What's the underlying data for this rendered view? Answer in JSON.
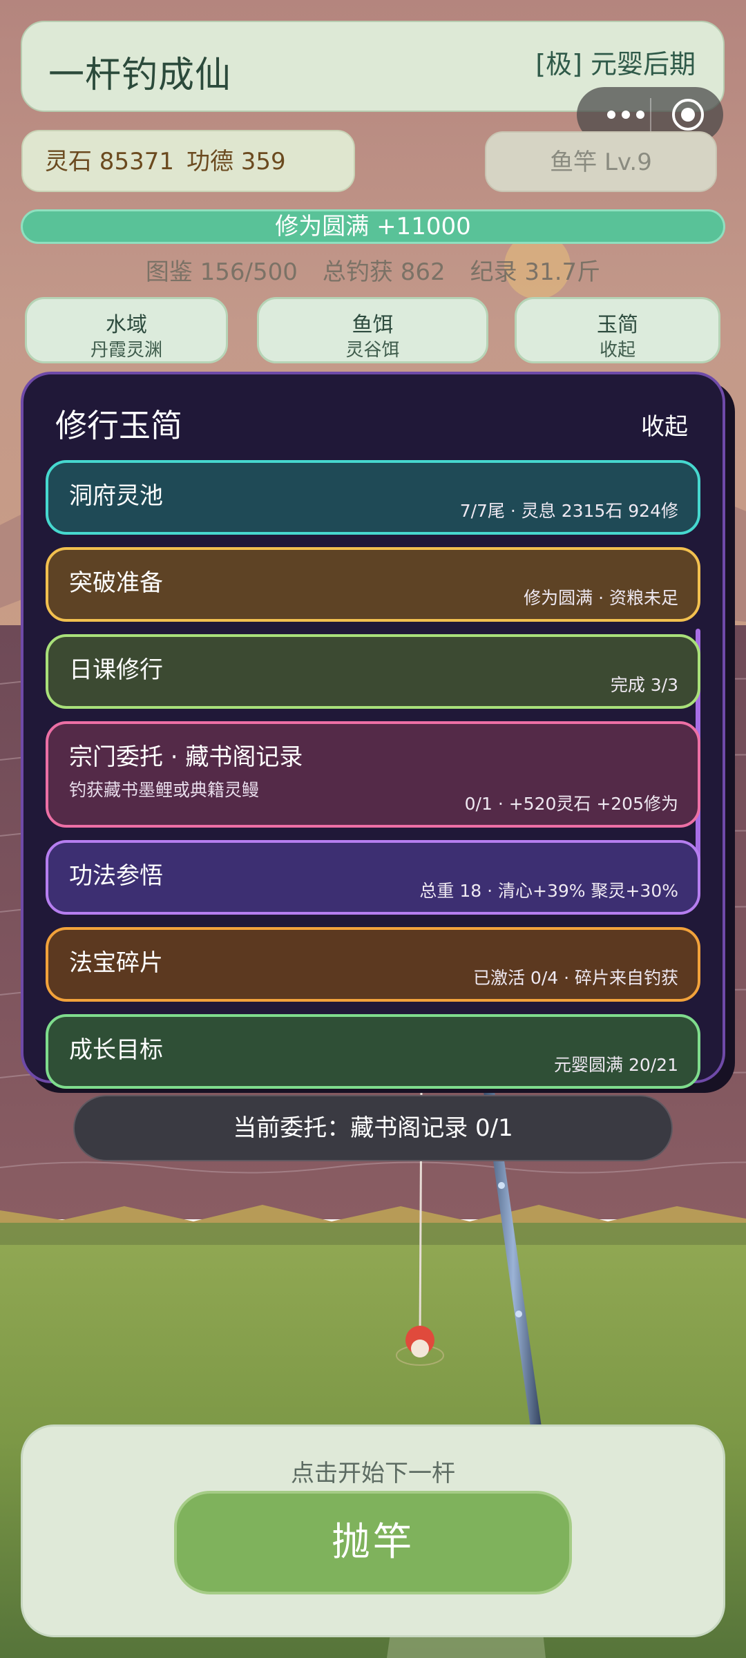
{
  "header": {
    "title": "一杆钓成仙",
    "realm": "[极] 元婴后期"
  },
  "resources": {
    "spirit_stone": "灵石 85371",
    "merit": "功德 359",
    "rod_level": "鱼竿 Lv.9"
  },
  "cultivation": {
    "bar_text": "修为圆满 +11000",
    "fill_fraction": 1.0
  },
  "stats": {
    "codex": "图鉴 156/500",
    "total_catch": "总钓获 862",
    "record": "纪录 31.7斤"
  },
  "selectors": [
    {
      "label": "水域",
      "value": "丹霞灵渊"
    },
    {
      "label": "鱼饵",
      "value": "灵谷饵"
    },
    {
      "label": "玉简",
      "value": "收起"
    }
  ],
  "panel": {
    "title": "修行玉简",
    "collapse_label": "收起",
    "tasks": [
      {
        "title": "洞府灵池",
        "info": "7/7尾 · 灵息 2315石 924修",
        "color": "#46d8cf"
      },
      {
        "title": "突破准备",
        "info": "修为圆满 · 资粮未足",
        "color": "#f2c04f"
      },
      {
        "title": "日课修行",
        "info": "完成 3/3",
        "color": "#a9e07a"
      },
      {
        "title": "宗门委托 · 藏书阁记录",
        "subtitle": "钓获藏书墨鲤或典籍灵鳗",
        "info": "0/1 · +520灵石 +205修为",
        "color": "#ec6fa5"
      },
      {
        "title": "功法参悟",
        "info": "总重 18 · 清心+39% 聚灵+30%",
        "color": "#b67ef0"
      },
      {
        "title": "法宝碎片",
        "info": "已激活 0/4 · 碎片来自钓获",
        "color": "#f2a23b"
      },
      {
        "title": "成长目标",
        "info": "元婴圆满 20/21",
        "color": "#7fdc8d"
      }
    ]
  },
  "commission_bar": "当前委托：藏书阁记录 0/1",
  "bottom": {
    "hint": "点击开始下一杆",
    "cast_button": "抛竿"
  },
  "colors": {
    "sky_top": "#b4857e",
    "water": "#7c5260",
    "grass": "#8ea54f",
    "panel_bg": "#201838",
    "panel_border": "#6f4aa8",
    "accent_green": "#59c298"
  }
}
